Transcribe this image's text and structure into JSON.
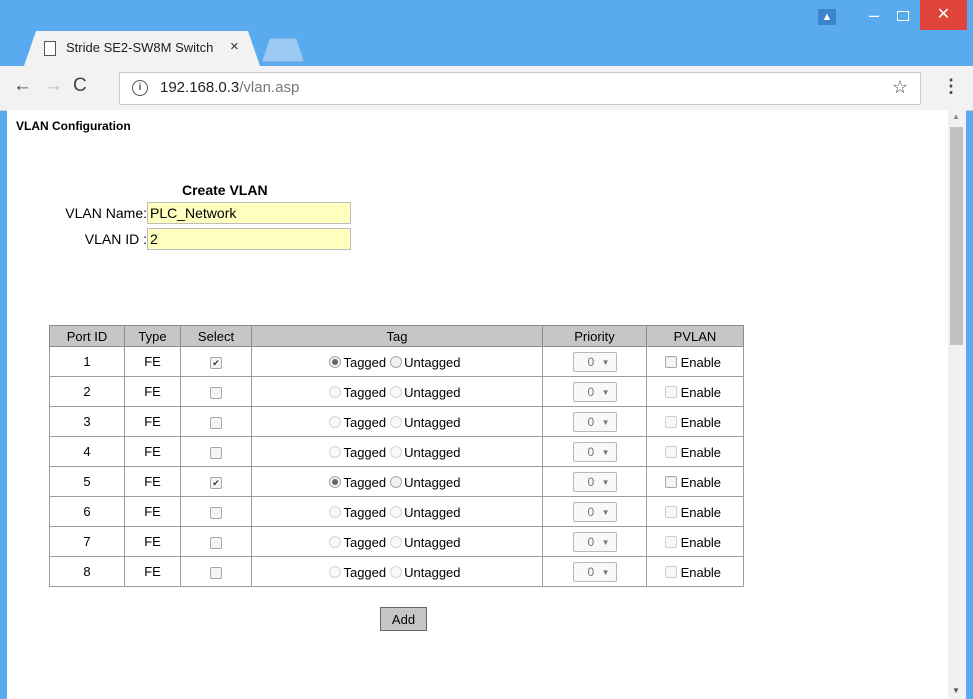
{
  "browser": {
    "tab_title": "Stride SE2-SW8M Switch",
    "tab_close": "×",
    "url_host": "192.168.0.3",
    "url_path": "/vlan.asp",
    "back_icon": "←",
    "forward_icon": "→",
    "reload_icon": "C",
    "info_icon": "i",
    "star_icon": "☆",
    "menu_icon": "⋮",
    "minimize_icon": "–",
    "close_icon": "✕",
    "user_icon": "▲"
  },
  "page": {
    "heading": "VLAN Configuration",
    "create_title": "Create VLAN",
    "vlan_name_label": "VLAN Name:",
    "vlan_name_value": "PLC_Network",
    "vlan_id_label": "VLAN ID :",
    "vlan_id_value": "2",
    "add_button": "Add"
  },
  "table": {
    "headers": [
      "Port ID",
      "Type",
      "Select",
      "Tag",
      "Priority",
      "PVLAN"
    ],
    "tagged_label": "Tagged",
    "untagged_label": "Untagged",
    "enable_label": "Enable",
    "rows": [
      {
        "port": "1",
        "type": "FE",
        "selected": true,
        "tag": "tagged",
        "priority": "0",
        "pvlan": false
      },
      {
        "port": "2",
        "type": "FE",
        "selected": false,
        "tag": "none",
        "priority": "0",
        "pvlan": false
      },
      {
        "port": "3",
        "type": "FE",
        "selected": false,
        "tag": "none",
        "priority": "0",
        "pvlan": false
      },
      {
        "port": "4",
        "type": "FE",
        "selected": false,
        "tag": "none",
        "priority": "0",
        "pvlan": false
      },
      {
        "port": "5",
        "type": "FE",
        "selected": true,
        "tag": "tagged",
        "priority": "0",
        "pvlan": false
      },
      {
        "port": "6",
        "type": "FE",
        "selected": false,
        "tag": "none",
        "priority": "0",
        "pvlan": false
      },
      {
        "port": "7",
        "type": "FE",
        "selected": false,
        "tag": "none",
        "priority": "0",
        "pvlan": false
      },
      {
        "port": "8",
        "type": "FE",
        "selected": false,
        "tag": "none",
        "priority": "0",
        "pvlan": false
      }
    ]
  },
  "colors": {
    "titlebar": "#5aaaf0",
    "close_button": "#e0433a",
    "input_bg": "#ffffc0",
    "header_bg": "#c6c6c6"
  }
}
